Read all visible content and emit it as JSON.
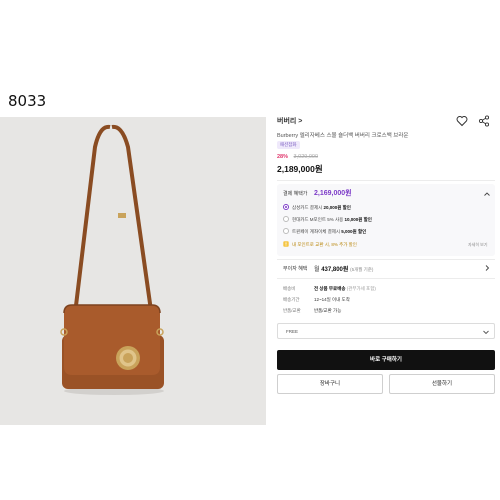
{
  "page_code": "8033",
  "product": {
    "brand_link": "버버리 >",
    "name": "Burberry 엘리자베스 스몰 숄더백 버버리 크로스백 브라운",
    "category_chip": "패션잡화",
    "discount_rate": "28%",
    "original_price": "3,029,000",
    "sale_price": "2,189,000원"
  },
  "benefit": {
    "label": "결제 혜택가",
    "price": "2,169,000원",
    "options": [
      {
        "text_pre": "삼성카드 결제시 ",
        "text_bold": "20,000원 할인",
        "selected": true
      },
      {
        "text_pre": "현대카드 M포인트 5% 사용 ",
        "text_bold": "10,000원 할인",
        "selected": false
      },
      {
        "text_pre": "트윈페이 계좌이체 결제시 ",
        "text_bold": "5,000원 할인",
        "selected": false
      }
    ],
    "warning": "내 포인트로 교환 시, 8% 추가 할인",
    "detail_link": "자세히 보기"
  },
  "installment": {
    "label": "무이자 혜택",
    "prefix": "월",
    "amount": "437,800원",
    "note": "(5개월 기준)"
  },
  "shipping": [
    {
      "label": "배송비",
      "value_bold": "전 상품 무료배송",
      "value_note": "(관부가세 포함)"
    },
    {
      "label": "배송기간",
      "value_bold": "",
      "value_note": "12~14일 이내 도착"
    },
    {
      "label": "반품/교환",
      "value_bold": "",
      "value_note": "반품/교환 가능"
    }
  ],
  "option_select": {
    "value": "FREE"
  },
  "actions": {
    "buy": "바로 구매하기",
    "cart": "장바구니",
    "gift": "선물하기"
  },
  "colors": {
    "accent_purple": "#7d3cc8",
    "discount_red": "#e0356b",
    "bag_brown": "#a45b2b"
  }
}
